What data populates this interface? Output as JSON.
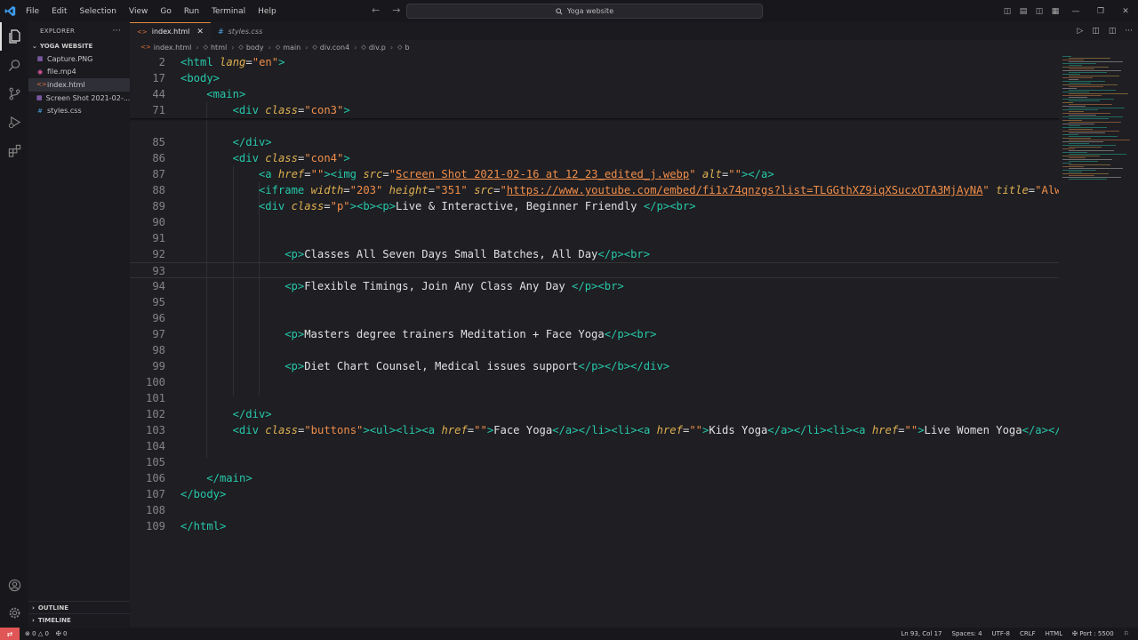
{
  "titlebar": {
    "menu": [
      "File",
      "Edit",
      "Selection",
      "View",
      "Go",
      "Run",
      "Terminal",
      "Help"
    ],
    "search_text": "Yoga website"
  },
  "sidebar": {
    "header": "EXPLORER",
    "header_more": "···",
    "folder": "YOGA WEBSITE",
    "files": [
      {
        "name": "Capture.PNG",
        "icon": "image-file-icon",
        "color": "#b07ce8"
      },
      {
        "name": "file.mp4",
        "icon": "video-file-icon",
        "color": "#e05aa0"
      },
      {
        "name": "index.html",
        "icon": "html-file-icon",
        "color": "#e8743b",
        "active": true
      },
      {
        "name": "Screen Shot 2021-02-...",
        "icon": "image-file-icon",
        "color": "#b07ce8"
      },
      {
        "name": "styles.css",
        "icon": "css-file-icon",
        "color": "#4aa3df"
      }
    ],
    "outline": "OUTLINE",
    "timeline": "TIMELINE"
  },
  "tabs": [
    {
      "label": "index.html",
      "active": true
    },
    {
      "label": "styles.css",
      "active": false
    }
  ],
  "breadcrumb": [
    "index.html",
    "html",
    "body",
    "main",
    "div.con4",
    "div.p",
    "b"
  ],
  "editor": {
    "lines": [
      {
        "n": "2",
        "indent": 0,
        "html": "<span class=\"tag\">&lt;html</span> <span class=\"attr\">lang</span>=<span class=\"val\">\"en\"</span><span class=\"tag\">&gt;</span>"
      },
      {
        "n": "17",
        "indent": 0,
        "html": "<span class=\"tag\">&lt;body&gt;</span>"
      },
      {
        "n": "44",
        "indent": 1,
        "html": "<span class=\"tag\">&lt;main&gt;</span>"
      },
      {
        "n": "71",
        "indent": 2,
        "html": "<span class=\"tag\">&lt;div</span> <span class=\"attr\">class</span>=<span class=\"val\">\"con3\"</span><span class=\"tag\">&gt;</span>"
      },
      {
        "n": "",
        "indent": 2,
        "html": ""
      },
      {
        "n": "85",
        "indent": 2,
        "html": "<span class=\"tag\">&lt;/div&gt;</span>"
      },
      {
        "n": "86",
        "indent": 2,
        "html": "<span class=\"tag\">&lt;div</span> <span class=\"attr\">class</span>=<span class=\"val\">\"con4\"</span><span class=\"tag\">&gt;</span>"
      },
      {
        "n": "87",
        "indent": 3,
        "html": "<span class=\"tag\">&lt;a</span> <span class=\"attr\">href</span>=<span class=\"val\">\"\"</span><span class=\"tag\">&gt;&lt;img</span> <span class=\"attr\">src</span>=<span class=\"val\">\"<span style=\"text-decoration:underline\">Screen Shot 2021-02-16 at 12_23_edited_j.webp</span>\"</span> <span class=\"attr\">alt</span>=<span class=\"val\">\"\"</span><span class=\"tag\">&gt;&lt;/a&gt;</span>"
      },
      {
        "n": "88",
        "indent": 3,
        "html": "<span class=\"tag\">&lt;iframe</span> <span class=\"attr\">width</span>=<span class=\"val\">\"203\"</span> <span class=\"attr\">height</span>=<span class=\"val\">\"351\"</span> <span class=\"attr\">src</span>=<span class=\"val\">\"<span style=\"text-decoration:underline\">https://www.youtube.com/embed/fi1x74qnzgs?list=TLGGthXZ9iqXSucxOTA3MjAyNA</span>\"</span> <span class=\"attr\">title</span>=<span class=\"val\">\"Alw</span>"
      },
      {
        "n": "89",
        "indent": 3,
        "html": "<span class=\"tag\">&lt;div</span> <span class=\"attr\">class</span>=<span class=\"val\">\"p\"</span><span class=\"tag\">&gt;&lt;b&gt;&lt;p&gt;</span><span class=\"txt\">Live &amp; Interactive, Beginner Friendly </span><span class=\"tag\">&lt;/p&gt;&lt;br&gt;</span>"
      },
      {
        "n": "90",
        "indent": 0,
        "html": ""
      },
      {
        "n": "91",
        "indent": 0,
        "html": ""
      },
      {
        "n": "92",
        "indent": 4,
        "html": "<span class=\"tag\">&lt;p&gt;</span><span class=\"txt\">Classes All Seven Days Small Batches, All Day</span><span class=\"tag\">&lt;/p&gt;&lt;br&gt;</span>"
      },
      {
        "n": "93",
        "indent": 0,
        "html": "",
        "current": true
      },
      {
        "n": "94",
        "indent": 4,
        "html": "<span class=\"tag\">&lt;p&gt;</span><span class=\"txt\">Flexible Timings, Join Any Class Any Day </span><span class=\"tag\">&lt;/p&gt;&lt;br&gt;</span>"
      },
      {
        "n": "95",
        "indent": 0,
        "html": ""
      },
      {
        "n": "96",
        "indent": 0,
        "html": ""
      },
      {
        "n": "97",
        "indent": 4,
        "html": "<span class=\"tag\">&lt;p&gt;</span><span class=\"txt\">Masters degree trainers Meditation + Face Yoga</span><span class=\"tag\">&lt;/p&gt;&lt;br&gt;</span>"
      },
      {
        "n": "98",
        "indent": 0,
        "html": ""
      },
      {
        "n": "99",
        "indent": 4,
        "html": "<span class=\"tag\">&lt;p&gt;</span><span class=\"txt\">Diet Chart Counsel, Medical issues support</span><span class=\"tag\">&lt;/p&gt;&lt;/b&gt;&lt;/div&gt;</span>"
      },
      {
        "n": "100",
        "indent": 0,
        "html": ""
      },
      {
        "n": "101",
        "indent": 0,
        "html": ""
      },
      {
        "n": "102",
        "indent": 2,
        "html": "<span class=\"tag\">&lt;/div&gt;</span>"
      },
      {
        "n": "103",
        "indent": 2,
        "html": "<span class=\"tag\">&lt;div</span> <span class=\"attr\">class</span>=<span class=\"val\">\"buttons\"</span><span class=\"tag\">&gt;&lt;ul&gt;&lt;li&gt;&lt;a</span> <span class=\"attr\">href</span>=<span class=\"val\">\"\"</span><span class=\"tag\">&gt;</span><span class=\"txt\">Face Yoga</span><span class=\"tag\">&lt;/a&gt;&lt;/li&gt;&lt;li&gt;&lt;a</span> <span class=\"attr\">href</span>=<span class=\"val\">\"\"</span><span class=\"tag\">&gt;</span><span class=\"txt\">Kids Yoga</span><span class=\"tag\">&lt;/a&gt;&lt;/li&gt;&lt;li&gt;&lt;a</span> <span class=\"attr\">href</span>=<span class=\"val\">\"\"</span><span class=\"tag\">&gt;</span><span class=\"txt\">Live Women Yoga</span><span class=\"tag\">&lt;/a&gt;&lt;/</span>"
      },
      {
        "n": "104",
        "indent": 0,
        "html": ""
      },
      {
        "n": "105",
        "indent": 0,
        "html": ""
      },
      {
        "n": "106",
        "indent": 1,
        "html": "<span class=\"tag\">&lt;/main&gt;</span>"
      },
      {
        "n": "107",
        "indent": 0,
        "html": "<span class=\"tag\">&lt;/body&gt;</span>"
      },
      {
        "n": "108",
        "indent": 0,
        "html": ""
      },
      {
        "n": "109",
        "indent": 0,
        "html": "<span class=\"tag\">&lt;/html&gt;</span>"
      }
    ]
  },
  "status": {
    "errors": "0",
    "warnings": "0",
    "ports_count": "0",
    "position": "Ln 93, Col 17",
    "spaces": "Spaces: 4",
    "encoding": "UTF-8",
    "eol": "CRLF",
    "language": "HTML",
    "port": "Port : 5500"
  },
  "colors": {
    "tag": "#27c8a8",
    "attr": "#e0b050",
    "string": "#f08d49",
    "accent": "#e48a3e",
    "remote": "#e05555"
  }
}
